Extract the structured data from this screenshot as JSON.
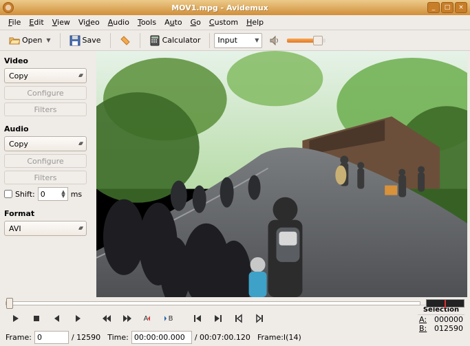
{
  "window": {
    "title": "MOV1.mpg - Avidemux"
  },
  "menu": {
    "file": "File",
    "edit": "Edit",
    "view": "View",
    "video": "Video",
    "audio": "Audio",
    "tools": "Tools",
    "auto": "Auto",
    "go": "Go",
    "custom": "Custom",
    "help": "Help"
  },
  "toolbar": {
    "open": "Open",
    "save": "Save",
    "calculator": "Calculator",
    "input": "Input"
  },
  "video": {
    "header": "Video",
    "codec": "Copy",
    "configure": "Configure",
    "filters": "Filters"
  },
  "audio": {
    "header": "Audio",
    "codec": "Copy",
    "configure": "Configure",
    "filters": "Filters",
    "shift_label": "Shift:",
    "shift_value": "0",
    "shift_unit": "ms"
  },
  "format": {
    "header": "Format",
    "value": "AVI"
  },
  "selection": {
    "header": "Selection",
    "a_label": "A:",
    "a_value": "000000",
    "b_label": "B:",
    "b_value": "012590"
  },
  "status": {
    "frame_label": "Frame:",
    "frame_value": "0",
    "frame_total": "/ 12590",
    "time_label": "Time:",
    "time_value": "00:00:00.000",
    "time_total": "/ 00:07:00.120",
    "frame_type": "Frame:I(14)"
  }
}
